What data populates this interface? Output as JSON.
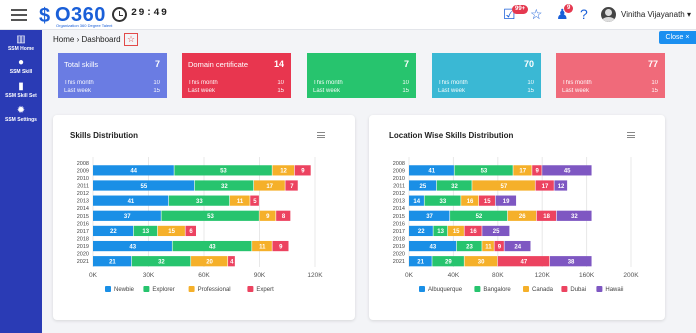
{
  "header": {
    "logo_text": "O360",
    "logo_subtitle": "Organization 360 Degree Talent",
    "timer": "29:49",
    "notifications_count": "99+",
    "alerts_count": "9",
    "username": "Vinitha Vijayanath ▾",
    "icons": [
      "menu-icon",
      "clock-icon",
      "notification-icon",
      "star-icon",
      "alert-icon",
      "help-icon",
      "avatar-icon"
    ]
  },
  "sidebar": {
    "items": [
      {
        "label": "SSM Home",
        "icon": "chart-icon"
      },
      {
        "label": "SSM Skill",
        "icon": "cloud-icon"
      },
      {
        "label": "SSM Skill Set",
        "icon": "bookmark-icon"
      },
      {
        "label": "SSM Settings",
        "icon": "gear-icon"
      }
    ]
  },
  "breadcrumb": {
    "home": "Home",
    "separator": "›",
    "current": "Dashboard"
  },
  "close_label": "Close ×",
  "cards": [
    {
      "title": "Total skills",
      "value": "7",
      "this_month_label": "This month",
      "this_month": "10",
      "last_week_label": "Last week",
      "last_week": "15",
      "color": "#6a7ce3"
    },
    {
      "title": "Domain certificate",
      "value": "14",
      "this_month_label": "This month",
      "this_month": "10",
      "last_week_label": "Last week",
      "last_week": "15",
      "color": "#e8364f"
    },
    {
      "title": "",
      "value": "7",
      "this_month_label": "This month",
      "this_month": "10",
      "last_week_label": "Last week",
      "last_week": "15",
      "color": "#27c46e"
    },
    {
      "title": "",
      "value": "70",
      "this_month_label": "This month",
      "this_month": "10",
      "last_week_label": "Last week",
      "last_week": "15",
      "color": "#3ab8d4"
    },
    {
      "title": "",
      "value": "77",
      "this_month_label": "This month",
      "this_month": "10",
      "last_week_label": "Last week",
      "last_week": "15",
      "color": "#f06a7a"
    }
  ],
  "chart_data": [
    {
      "type": "bar",
      "orientation": "horizontal",
      "stacked": true,
      "title": "Skills Distribution",
      "categories": [
        "2008",
        "2009",
        "2010",
        "2011",
        "2012",
        "2013",
        "2014",
        "2015",
        "2016",
        "2017",
        "2018",
        "2019",
        "2020",
        "2021"
      ],
      "series": [
        {
          "name": "Newbie",
          "color": "#1a8fe6",
          "values": [
            null,
            44,
            null,
            55,
            null,
            41,
            null,
            37,
            null,
            22,
            null,
            43,
            null,
            21
          ]
        },
        {
          "name": "Explorer",
          "color": "#27c46e",
          "values": [
            null,
            53,
            null,
            32,
            null,
            33,
            null,
            53,
            null,
            13,
            null,
            43,
            null,
            32
          ]
        },
        {
          "name": "Professional",
          "color": "#f5b02a",
          "values": [
            null,
            12,
            null,
            17,
            null,
            11,
            null,
            9,
            null,
            15,
            null,
            11,
            null,
            20
          ]
        },
        {
          "name": "Expert",
          "color": "#ec4360",
          "values": [
            null,
            9,
            null,
            7,
            null,
            5,
            null,
            8,
            null,
            6,
            null,
            9,
            null,
            4
          ]
        }
      ],
      "xlim": [
        0,
        120000
      ],
      "x_ticks": [
        "0K",
        "30K",
        "60K",
        "90K",
        "120K"
      ],
      "legend_position": "bottom",
      "grid": true
    },
    {
      "type": "bar",
      "orientation": "horizontal",
      "stacked": true,
      "title": "Location Wise Skills Distribution",
      "categories": [
        "2008",
        "2009",
        "2010",
        "2011",
        "2012",
        "2013",
        "2014",
        "2015",
        "2016",
        "2017",
        "2018",
        "2019",
        "2020",
        "2021"
      ],
      "series": [
        {
          "name": "Albuquerque",
          "color": "#1a8fe6",
          "values": [
            null,
            41,
            null,
            25,
            null,
            14,
            null,
            37,
            null,
            22,
            null,
            43,
            null,
            21
          ]
        },
        {
          "name": "Bangalore",
          "color": "#27c46e",
          "values": [
            null,
            53,
            null,
            32,
            null,
            33,
            null,
            52,
            null,
            13,
            null,
            23,
            null,
            29
          ]
        },
        {
          "name": "Canada",
          "color": "#f5b02a",
          "values": [
            null,
            17,
            null,
            57,
            null,
            16,
            null,
            26,
            null,
            15,
            null,
            11,
            null,
            30
          ]
        },
        {
          "name": "Dubai",
          "color": "#ec4360",
          "values": [
            null,
            9,
            null,
            17,
            null,
            15,
            null,
            18,
            null,
            16,
            null,
            9,
            null,
            47
          ]
        },
        {
          "name": "Hawaii",
          "color": "#7e57c2",
          "values": [
            null,
            45,
            null,
            12,
            null,
            19,
            null,
            32,
            null,
            25,
            null,
            24,
            null,
            38
          ]
        }
      ],
      "xlim": [
        0,
        200000
      ],
      "x_ticks": [
        "0K",
        "40K",
        "80K",
        "120K",
        "160K",
        "200K"
      ],
      "legend_position": "bottom",
      "grid": true
    }
  ]
}
